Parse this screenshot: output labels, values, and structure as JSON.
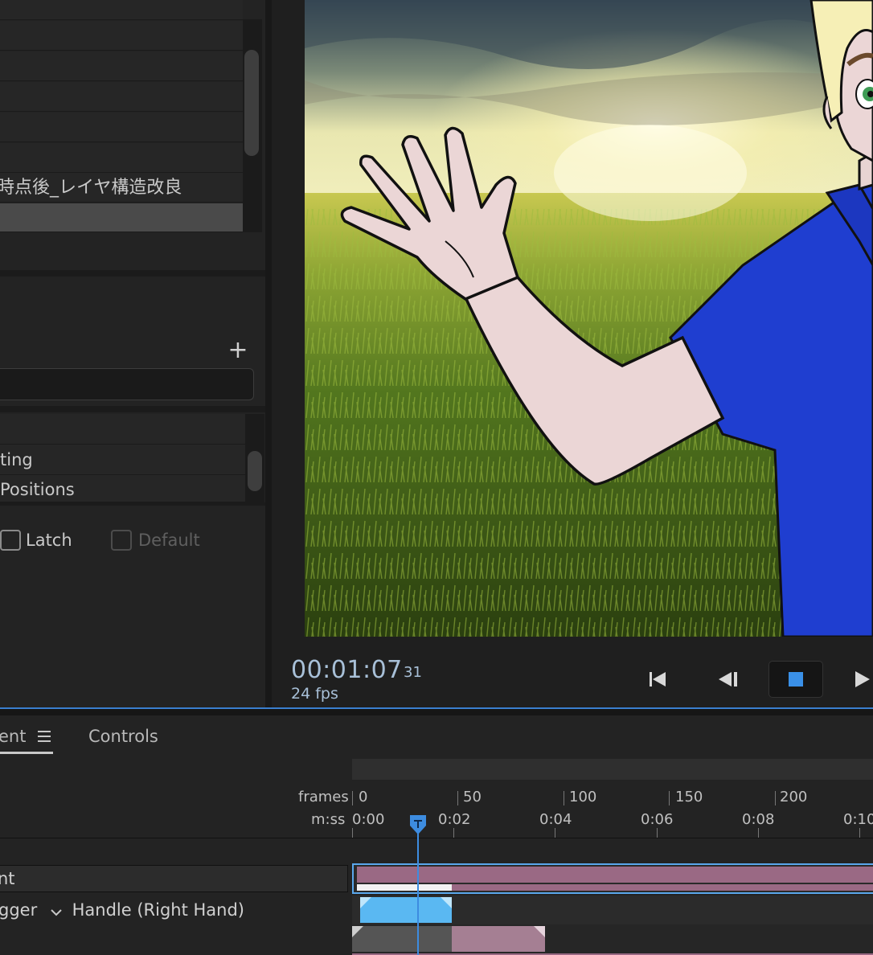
{
  "project_list": {
    "items": [
      {
        "label": ""
      },
      {
        "label": ""
      },
      {
        "label": ""
      },
      {
        "label": ""
      },
      {
        "label": ""
      },
      {
        "label": "時点後_レイヤ構造改良"
      },
      {
        "label": ""
      }
    ]
  },
  "behaviors": {
    "add_symbol": "+",
    "items": [
      {
        "label": ""
      },
      {
        "label": "ting"
      },
      {
        "label": " Positions"
      }
    ]
  },
  "trigger_options": {
    "latch_label": "Latch",
    "default_label": "Default"
  },
  "transport": {
    "timecode": "00:01:07",
    "frame": "31",
    "fps": "24 fps"
  },
  "timeline": {
    "tabs": [
      {
        "label": "ent"
      },
      {
        "label": "Controls"
      }
    ],
    "ruler": {
      "frames_label": "frames",
      "time_label": "m:ss",
      "frame_ticks": [
        "0",
        "50",
        "100",
        "150",
        "200"
      ],
      "time_ticks": [
        "0:00",
        "0:02",
        "0:04",
        "0:06",
        "0:08",
        "0:10"
      ]
    },
    "tracks": [
      {
        "name": "nt"
      },
      {
        "name": "gger",
        "handle": "Handle (Right Hand)"
      }
    ]
  },
  "colors": {
    "accent": "#3d8ce0",
    "clip_pink": "#9a6984",
    "clip_blue": "#5ab8f2",
    "stop_icon": "#3a90e8",
    "timecode": "#a8c0d8"
  }
}
